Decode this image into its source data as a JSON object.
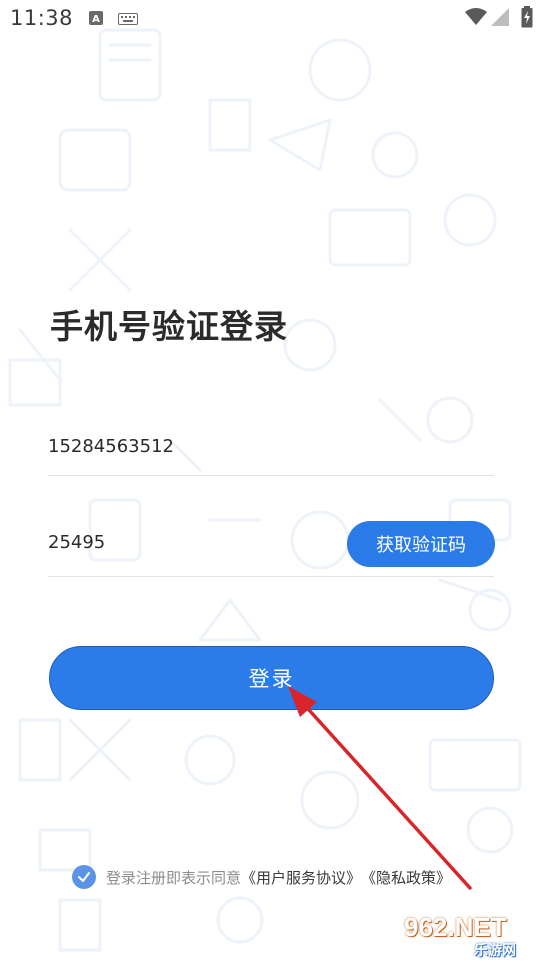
{
  "status_bar": {
    "time": "11:38",
    "icons": [
      "notification-a-icon",
      "keyboard-icon",
      "wifi-icon",
      "signal-icon",
      "battery-icon"
    ]
  },
  "page": {
    "title": "手机号验证登录"
  },
  "form": {
    "phone_value": "15284563512",
    "code_value": "25495",
    "get_code_label": "获取验证码",
    "login_label": "登录"
  },
  "agreement": {
    "checked": true,
    "text": "登录注册即表示同意",
    "user_agreement": "《用户服务协议》",
    "privacy_policy": "《隐私政策》"
  },
  "watermark": {
    "brand": "962.NET",
    "sub": "乐游网"
  },
  "colors": {
    "primary": "#2b7ce9",
    "annotation_arrow": "#d9252a"
  }
}
